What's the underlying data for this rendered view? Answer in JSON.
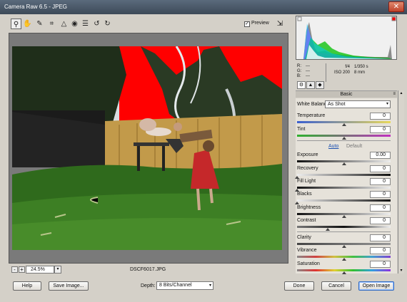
{
  "window": {
    "title": "Camera Raw 6.5  -  JPEG",
    "close_icon": "close-icon"
  },
  "toolbar": {
    "tools": [
      "zoom-icon",
      "hand-icon",
      "eyedropper-icon",
      "crop-icon",
      "straighten-icon",
      "redeye-icon",
      "preferences-icon",
      "rotate-ccw-icon",
      "rotate-cw-icon"
    ],
    "preview_label": "Preview",
    "preview_checked": true
  },
  "preview": {
    "filename": "DSCF6017.JPG"
  },
  "zoom": {
    "minus": "-",
    "plus": "+",
    "value": "24.5%"
  },
  "info": {
    "r_label": "R:",
    "r_value": "---",
    "g_label": "G:",
    "g_value": "---",
    "b_label": "B:",
    "b_value": "---",
    "aperture": "f/4",
    "shutter": "1/350 s",
    "iso": "ISO 200",
    "focal": "8 mm"
  },
  "panel": {
    "title": "Basic",
    "white_balance_label": "White Balance:",
    "white_balance_value": "As Shot",
    "auto_label": "Auto",
    "default_label": "Default",
    "sliders": {
      "temperature": {
        "label": "Temperature",
        "value": "0",
        "level": 0.5
      },
      "tint": {
        "label": "Tint",
        "value": "0",
        "level": 0.5
      },
      "exposure": {
        "label": "Exposure",
        "value": "0.00",
        "level": 0.5
      },
      "recovery": {
        "label": "Recovery",
        "value": "0",
        "level": 0
      },
      "fill_light": {
        "label": "Fill Light",
        "value": "0",
        "level": 0
      },
      "blacks": {
        "label": "Blacks",
        "value": "0",
        "level": 0
      },
      "brightness": {
        "label": "Brightness",
        "value": "0",
        "level": 0.5
      },
      "contrast": {
        "label": "Contrast",
        "value": "0",
        "level": 0.33
      },
      "clarity": {
        "label": "Clarity",
        "value": "0",
        "level": 0.5
      },
      "vibrance": {
        "label": "Vibrance",
        "value": "0",
        "level": 0.5
      },
      "saturation": {
        "label": "Saturation",
        "value": "0",
        "level": 0.5
      }
    }
  },
  "footer": {
    "help": "Help",
    "save_image": "Save Image...",
    "depth_label": "Depth:",
    "depth_value": "8 Bits/Channel",
    "done": "Done",
    "cancel": "Cancel",
    "open_image": "Open Image"
  },
  "colors": {
    "clipping_warning": "#ff0000",
    "link": "#1a4fb0"
  }
}
